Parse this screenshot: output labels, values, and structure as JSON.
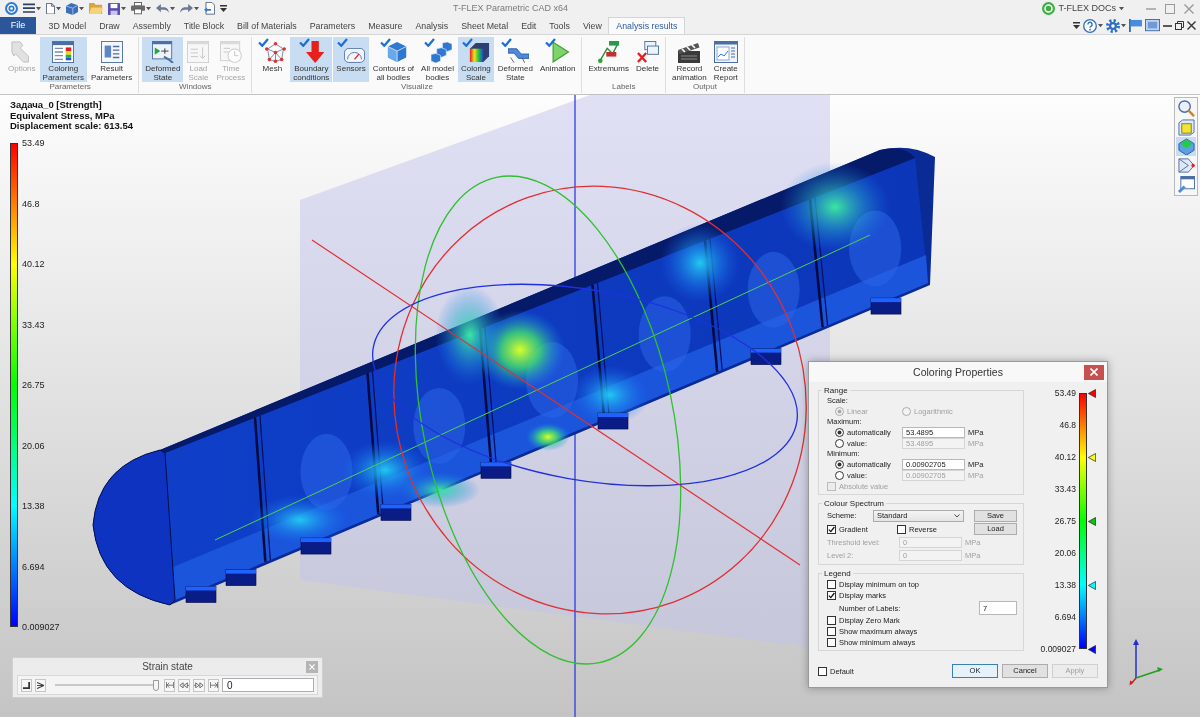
{
  "titlebar": {
    "title": "T-FLEX Parametric CAD x64",
    "docs": "T-FLEX DOCs"
  },
  "tabs": [
    {
      "label": "File",
      "kind": "file",
      "selected": false
    },
    {
      "label": "3D Model",
      "kind": "tab",
      "selected": false
    },
    {
      "label": "Draw",
      "kind": "tab",
      "selected": false
    },
    {
      "label": "Assembly",
      "kind": "tab",
      "selected": false
    },
    {
      "label": "Title Block",
      "kind": "tab",
      "selected": false
    },
    {
      "label": "Bill of Materials",
      "kind": "tab",
      "selected": false
    },
    {
      "label": "Parameters",
      "kind": "tab",
      "selected": false
    },
    {
      "label": "Measure",
      "kind": "tab",
      "selected": false
    },
    {
      "label": "Analysis",
      "kind": "tab",
      "selected": false
    },
    {
      "label": "Sheet Metal",
      "kind": "tab",
      "selected": false
    },
    {
      "label": "Edit",
      "kind": "tab",
      "selected": false
    },
    {
      "label": "Tools",
      "kind": "tab",
      "selected": false
    },
    {
      "label": "View",
      "kind": "tab",
      "selected": false
    },
    {
      "label": "Analysis results",
      "kind": "tab",
      "selected": true
    }
  ],
  "ribbon": [
    {
      "label": "Parameters",
      "buttons": [
        {
          "label": "Options",
          "selected": false,
          "disabled": true
        },
        {
          "label": "Coloring\nParameters",
          "selected": true,
          "disabled": false
        },
        {
          "label": "Result\nParameters",
          "selected": false,
          "disabled": false
        }
      ]
    },
    {
      "label": "Windows",
      "buttons": [
        {
          "label": "Deformed\nState",
          "selected": true,
          "disabled": false
        },
        {
          "label": "Load\nScale",
          "selected": false,
          "disabled": true
        },
        {
          "label": "Time\nProcess",
          "selected": false,
          "disabled": true
        }
      ]
    },
    {
      "label": "Visualize",
      "buttons": [
        {
          "label": "Mesh",
          "selected": false,
          "disabled": false,
          "checked": true
        },
        {
          "label": "Boundary\nconditions",
          "selected": true,
          "disabled": false,
          "checked": true
        },
        {
          "label": "Sensors",
          "selected": true,
          "disabled": false,
          "checked": true
        },
        {
          "label": "Contours of\nall bodies",
          "selected": false,
          "disabled": false,
          "checked": true
        },
        {
          "label": "All model\nbodies",
          "selected": false,
          "disabled": false,
          "checked": true
        },
        {
          "label": "Coloring\nScale",
          "selected": true,
          "disabled": false,
          "checked": true
        },
        {
          "label": "Deformed\nState",
          "selected": false,
          "disabled": false,
          "checked": true
        },
        {
          "label": "Animation",
          "selected": false,
          "disabled": false,
          "checked": true
        }
      ]
    },
    {
      "label": "Labels",
      "buttons": [
        {
          "label": "Extremums",
          "selected": false,
          "disabled": false
        },
        {
          "label": "Delete",
          "selected": false,
          "disabled": false
        }
      ]
    },
    {
      "label": "Output",
      "buttons": [
        {
          "label": "Record\nanimation",
          "selected": false,
          "disabled": false
        },
        {
          "label": "Create\nReport",
          "selected": false,
          "disabled": false
        }
      ]
    }
  ],
  "viewport": {
    "info": [
      "Задача_0 [Strength]",
      "Equivalent Stress, MPa",
      "Displacement scale: 613.54"
    ],
    "legend": [
      "53.49",
      "46.8",
      "40.12",
      "33.43",
      "26.75",
      "20.06",
      "13.38",
      "6.694",
      "0.009027"
    ],
    "view_tools": [
      {
        "selected": false
      },
      {
        "selected": false
      },
      {
        "selected": true
      },
      {
        "selected": false
      },
      {
        "selected": false
      }
    ]
  },
  "strain": {
    "title": "Strain state",
    "level": 1,
    "value": "0"
  },
  "dialog": {
    "title": "Coloring Properties",
    "range": {
      "label": "Range",
      "scale_label": "Scale:",
      "scale_options": [
        {
          "label": "Linear",
          "selected": true,
          "disabled": true
        },
        {
          "label": "Logarithmic",
          "selected": false,
          "disabled": true
        }
      ],
      "limits": [
        {
          "label": "Maximum:",
          "options": [
            {
              "label": "automatically",
              "selected": true,
              "value": "53.4895",
              "unit": "MPa"
            },
            {
              "label": "value:",
              "selected": false,
              "value": "53.4895",
              "unit": "MPa"
            }
          ]
        },
        {
          "label": "Minimum:",
          "options": [
            {
              "label": "automatically",
              "selected": true,
              "value": "0.00902705",
              "unit": "MPa"
            },
            {
              "label": "value:",
              "selected": false,
              "value": "0.00902705",
              "unit": "MPa"
            }
          ]
        }
      ],
      "absolute": {
        "label": "Absolute value",
        "checked": false,
        "disabled": true
      }
    },
    "spectrum": {
      "label": "Colour Spectrum",
      "scheme_label": "Scheme:",
      "scheme": "Standard",
      "save": "Save",
      "load": "Load",
      "gradient": {
        "label": "Gradient",
        "checked": true
      },
      "reverse": {
        "label": "Reverse",
        "checked": false
      },
      "levels": [
        {
          "label": "Threshold level:",
          "value": "0",
          "unit": "MPa",
          "disabled": true
        },
        {
          "label": "Level 2:",
          "value": "0",
          "unit": "MPa",
          "disabled": true
        }
      ]
    },
    "legend": {
      "label": "Legend",
      "items": [
        {
          "kind": "check",
          "label": "Display minimum on top",
          "checked": false
        },
        {
          "kind": "check",
          "label": "Display marks",
          "checked": true
        },
        {
          "kind": "number",
          "label": "Number of Labels:",
          "value": "7"
        },
        {
          "kind": "check",
          "label": "Display Zero Mark",
          "checked": false
        },
        {
          "kind": "check",
          "label": "Show maximum always",
          "checked": false
        },
        {
          "kind": "check",
          "label": "Show minimum always",
          "checked": false
        }
      ]
    },
    "default": {
      "label": "Default",
      "checked": false
    },
    "buttons": [
      {
        "label": "OK",
        "default": true,
        "disabled": false
      },
      {
        "label": "Cancel",
        "default": false,
        "disabled": false
      },
      {
        "label": "Apply",
        "default": false,
        "disabled": true
      }
    ],
    "scale": [
      {
        "label": "53.49",
        "marker": true,
        "color": "#ff0000"
      },
      {
        "label": "46.8",
        "marker": false
      },
      {
        "label": "40.12",
        "marker": true,
        "color": "#ffff00"
      },
      {
        "label": "33.43",
        "marker": false
      },
      {
        "label": "26.75",
        "marker": true,
        "color": "#00cc00"
      },
      {
        "label": "20.06",
        "marker": false
      },
      {
        "label": "13.38",
        "marker": true,
        "color": "#00ffff"
      },
      {
        "label": "6.694",
        "marker": false
      },
      {
        "label": "0.009027",
        "marker": true,
        "color": "#0000ff"
      }
    ]
  }
}
